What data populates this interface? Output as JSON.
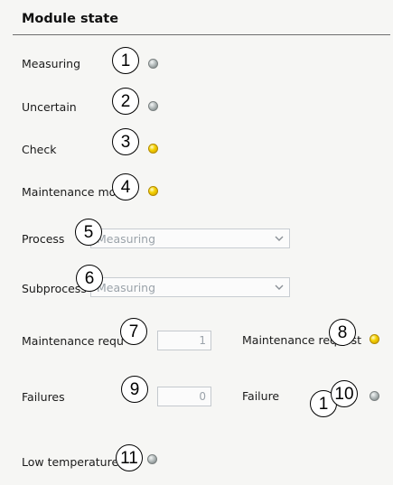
{
  "panel": {
    "title": "Module state"
  },
  "rows": {
    "measuring": {
      "label": "Measuring",
      "callout": "1",
      "led": "grey"
    },
    "uncertain": {
      "label": "Uncertain",
      "callout": "2",
      "led": "grey"
    },
    "check": {
      "label": "Check",
      "callout": "3",
      "led": "yellow"
    },
    "maintenance_mode": {
      "label": "Maintenance mode",
      "callout": "4",
      "led": "yellow"
    },
    "process": {
      "label": "Process",
      "callout": "5",
      "value": "Measuring"
    },
    "subprocess": {
      "label": "Subprocess",
      "callout": "6",
      "value": "Measuring"
    },
    "maintenance_requests": {
      "label": "Maintenance requ",
      "callout": "7",
      "value": "1"
    },
    "maintenance_request": {
      "label": "Maintenance request",
      "callout": "8",
      "led": "yellow"
    },
    "failures": {
      "label": "Failures",
      "callout": "9",
      "value": "0"
    },
    "failure": {
      "label": "Failure",
      "callout": "10",
      "callout_behind": "1",
      "led": "grey"
    },
    "low_temperature": {
      "label": "Low temperature",
      "callout": "11",
      "led": "grey"
    }
  },
  "icons": {
    "led": "status-led-icon",
    "chevron": "chevron-down-icon"
  },
  "colors": {
    "led_grey": "#9aa2a2",
    "led_yellow": "#f4d200",
    "header_rule": "#6e6e6e",
    "disabled_text": "#9ba3aa"
  }
}
